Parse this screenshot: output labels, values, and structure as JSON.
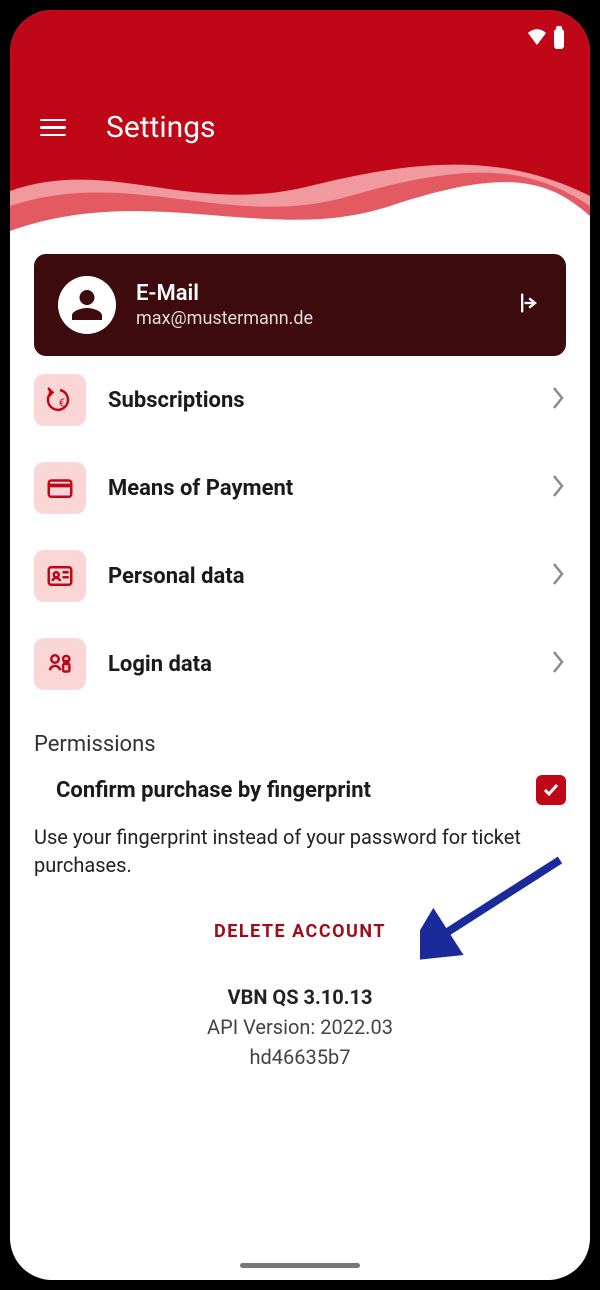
{
  "header": {
    "title": "Settings"
  },
  "account": {
    "label": "E-Mail",
    "value": "max@mustermann.de"
  },
  "menu": [
    {
      "label": "Subscriptions"
    },
    {
      "label": "Means of Payment"
    },
    {
      "label": "Personal data"
    },
    {
      "label": "Login data"
    }
  ],
  "permissions": {
    "section_title": "Permissions",
    "item_label": "Confirm purchase by fingerprint",
    "checked": true,
    "hint": "Use your fingerprint instead of your password for ticket purchases."
  },
  "delete_label": "DELETE ACCOUNT",
  "version": {
    "line1": "VBN QS 3.10.13",
    "line2": "API Version: 2022.03",
    "line3": "hd46635b7"
  },
  "colors": {
    "brand": "#c00718",
    "card": "#3d0a0d",
    "icon_bg": "#fbd6d6"
  }
}
